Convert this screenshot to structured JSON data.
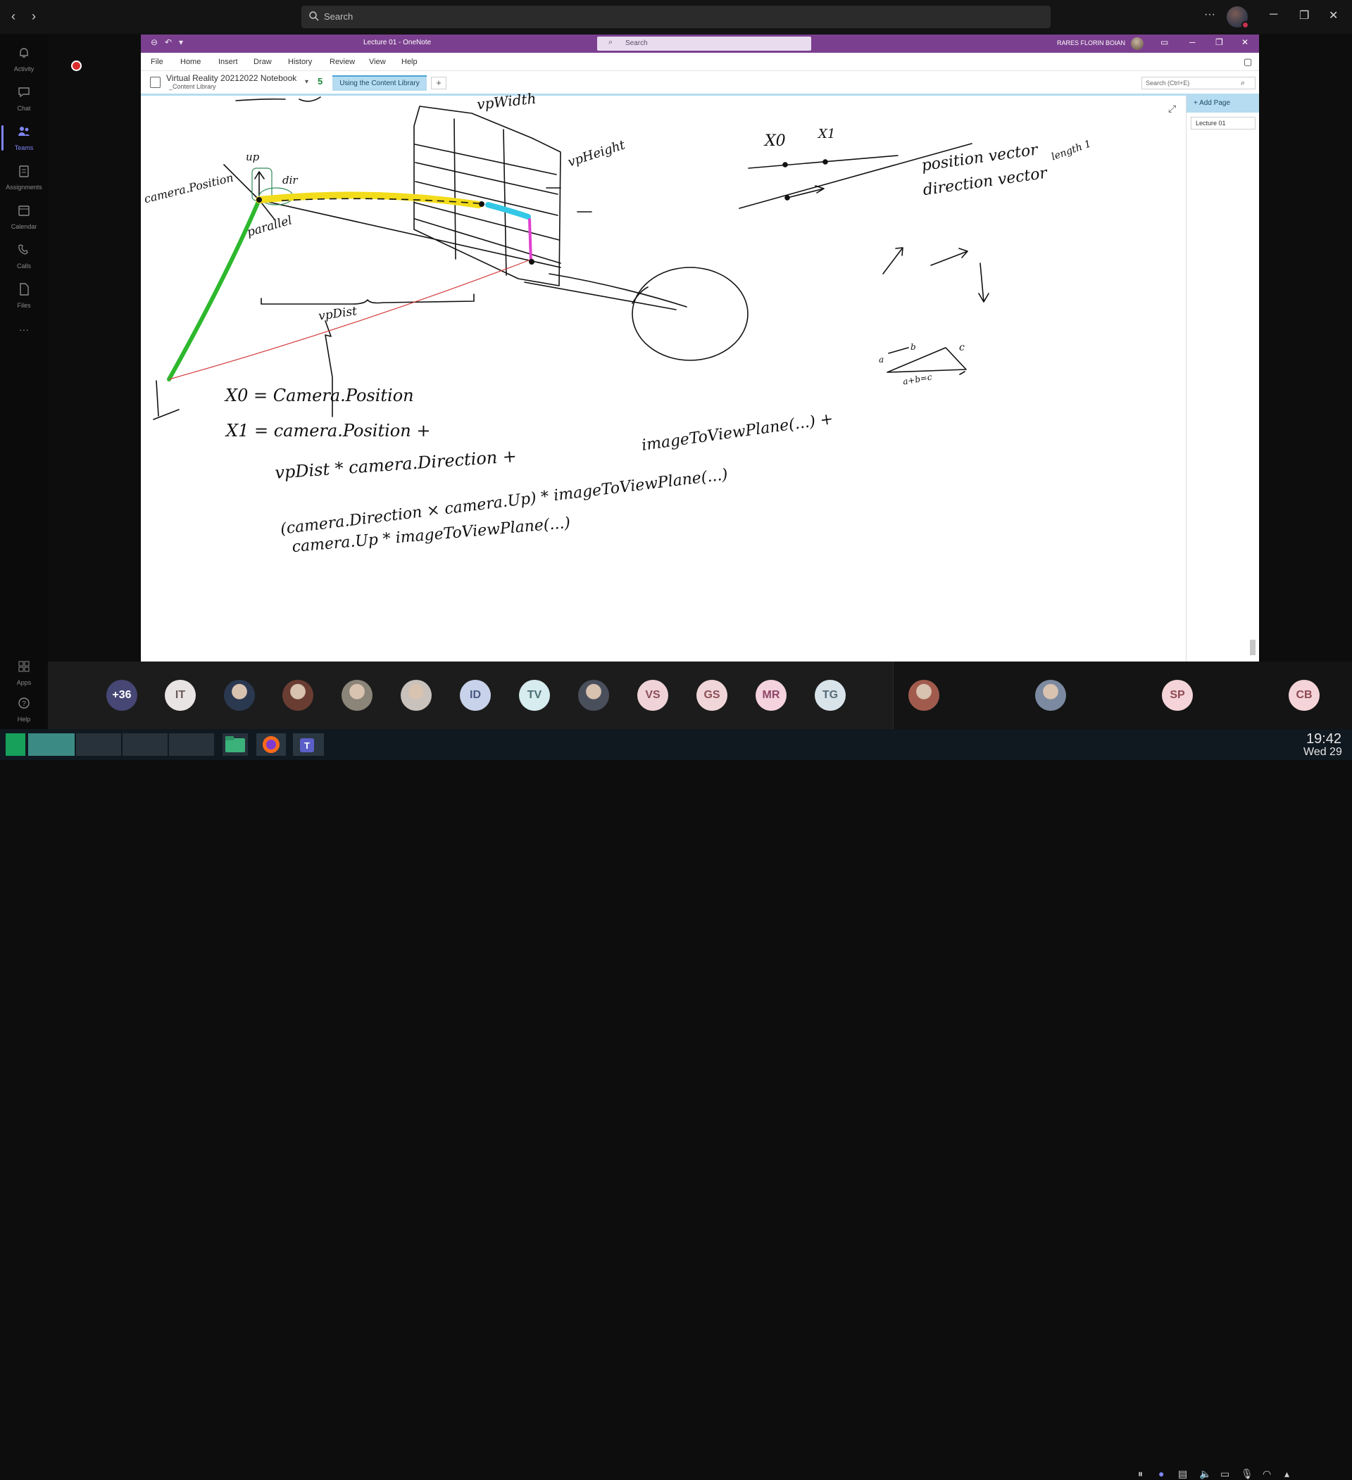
{
  "teams": {
    "search_placeholder": "Search",
    "more_label": "···",
    "rail": [
      {
        "label": "Activity",
        "icon": "bell-icon"
      },
      {
        "label": "Chat",
        "icon": "chat-icon"
      },
      {
        "label": "Teams",
        "icon": "teams-icon",
        "active": true
      },
      {
        "label": "Assignments",
        "icon": "assignments-icon"
      },
      {
        "label": "Calendar",
        "icon": "calendar-icon"
      },
      {
        "label": "Calls",
        "icon": "phone-icon"
      },
      {
        "label": "Files",
        "icon": "file-icon"
      },
      {
        "label": "···",
        "icon": "more-icon"
      },
      {
        "label": "Apps",
        "icon": "apps-icon"
      },
      {
        "label": "Help",
        "icon": "help-icon"
      }
    ]
  },
  "onenote": {
    "title": "Lecture 01  -  OneNote",
    "search_placeholder": "Search",
    "user_name": "RARES FLORIN BOIAN",
    "menu": [
      "File",
      "Home",
      "Insert",
      "Draw",
      "History",
      "Review",
      "View",
      "Help"
    ],
    "notebook_name": "Virtual Reality 20212022 Notebook",
    "notebook_section": "_Content Library",
    "notebook_count": "5",
    "section_tab": "Using the Content Library",
    "add_section": "+",
    "page_search_placeholder": "Search (Ctrl+E)",
    "add_page_label": "Add Page",
    "pages": [
      "Lecture 01"
    ]
  },
  "ink": {
    "vp_width": "vpWidth",
    "vp_height": "vpHeight",
    "up": "up",
    "dir": "dir",
    "camera_position": "camera.Position",
    "parallel": "parallel",
    "vp_dist": "vpDist",
    "x0_label": "X0",
    "x1_label": "X1",
    "position_vector": "position vector",
    "direction_vector": "direction vector",
    "length_one": "length 1",
    "triangle_a": "a",
    "triangle_b": "b",
    "triangle_c": "c",
    "triangle_sum": "a+b=c",
    "eq1": "X0 = Camera.Position",
    "eq2": "X1 = camera.Position +",
    "eq3": "vpDist * camera.Direction +",
    "eq3b": "imageToViewPlane(...) +",
    "eq4": "(camera.Direction × camera.Up) * imageToViewPlane(...)",
    "eq5": "camera.Up * imageToViewPlane(...)"
  },
  "participants": [
    {
      "initials": "+36",
      "bg": "#464775",
      "fg": "#ffffff"
    },
    {
      "initials": "IT",
      "bg": "#e9e4e4",
      "fg": "#6b5b5b"
    },
    {
      "initials": "",
      "photo": true,
      "bg": "#2a3850"
    },
    {
      "initials": "",
      "photo": true,
      "bg": "#6a3d33"
    },
    {
      "initials": "",
      "photo": true,
      "bg": "#8b8478"
    },
    {
      "initials": "",
      "photo": true,
      "bg": "#c9c2bc"
    },
    {
      "initials": "ID",
      "bg": "#c8d2ea",
      "fg": "#4a5b82"
    },
    {
      "initials": "TV",
      "bg": "#d6ecef",
      "fg": "#4b6f74"
    },
    {
      "initials": "",
      "photo": true,
      "bg": "#4a4f5c"
    },
    {
      "initials": "VS",
      "bg": "#efd3d8",
      "fg": "#8b4f5a"
    },
    {
      "initials": "GS",
      "bg": "#f0d6d9",
      "fg": "#8c5058"
    },
    {
      "initials": "MR",
      "bg": "#f4d2de",
      "fg": "#8e4665"
    },
    {
      "initials": "TG",
      "bg": "#d9e4ea",
      "fg": "#566b78"
    },
    {
      "initials": "",
      "photo": true,
      "bg": "#a15b4d"
    },
    {
      "initials": "",
      "photo": true,
      "bg": "#7b8aa0"
    },
    {
      "initials": "SP",
      "bg": "#f4d4d8",
      "fg": "#8e4a54"
    },
    {
      "initials": "CB",
      "bg": "#f4d4d8",
      "fg": "#8e4a54"
    }
  ],
  "taskbar": {
    "time": "19:42",
    "date": "Wed 29"
  }
}
